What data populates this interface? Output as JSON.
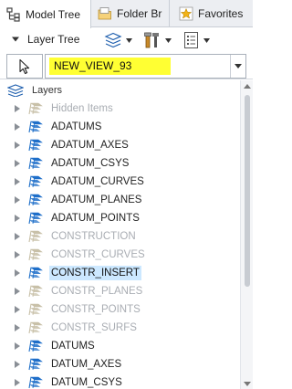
{
  "tabs": [
    {
      "label": "Model Tree",
      "icon": "model-tree-icon",
      "active": true
    },
    {
      "label": "Folder Br",
      "icon": "folder-browser-icon",
      "active": false
    },
    {
      "label": "Favorites",
      "icon": "favorites-icon",
      "active": false
    }
  ],
  "toolbar": {
    "title": "Layer Tree",
    "buttons": [
      {
        "icon": "layer-display-icon",
        "has_dropdown": true
      },
      {
        "icon": "tools-icon",
        "has_dropdown": true
      },
      {
        "icon": "settings-list-icon",
        "has_dropdown": true
      }
    ]
  },
  "selector": {
    "value": "NEW_VIEW_93",
    "highlight_color": "#ffff33"
  },
  "tree": {
    "root_label": "Layers",
    "items": [
      {
        "label": "Hidden Items",
        "state": "hidden"
      },
      {
        "label": "ADATUMS",
        "state": "shown"
      },
      {
        "label": "ADATUM_AXES",
        "state": "shown"
      },
      {
        "label": "ADATUM_CSYS",
        "state": "shown"
      },
      {
        "label": "ADATUM_CURVES",
        "state": "shown"
      },
      {
        "label": "ADATUM_PLANES",
        "state": "shown"
      },
      {
        "label": "ADATUM_POINTS",
        "state": "shown"
      },
      {
        "label": "CONSTRUCTION",
        "state": "hidden"
      },
      {
        "label": "CONSTR_CURVES",
        "state": "hidden"
      },
      {
        "label": "CONSTR_INSERT",
        "state": "selected"
      },
      {
        "label": "CONSTR_PLANES",
        "state": "hidden"
      },
      {
        "label": "CONSTR_POINTS",
        "state": "hidden"
      },
      {
        "label": "CONSTR_SURFS",
        "state": "hidden"
      },
      {
        "label": "DATUMS",
        "state": "shown"
      },
      {
        "label": "DATUM_AXES",
        "state": "shown"
      },
      {
        "label": "DATUM_CSYS",
        "state": "shown"
      }
    ]
  },
  "colors": {
    "layer_icon_shown": "#1f6fc9",
    "layer_icon_hidden": "#c8c0a8",
    "selection": "#cce8ff"
  }
}
